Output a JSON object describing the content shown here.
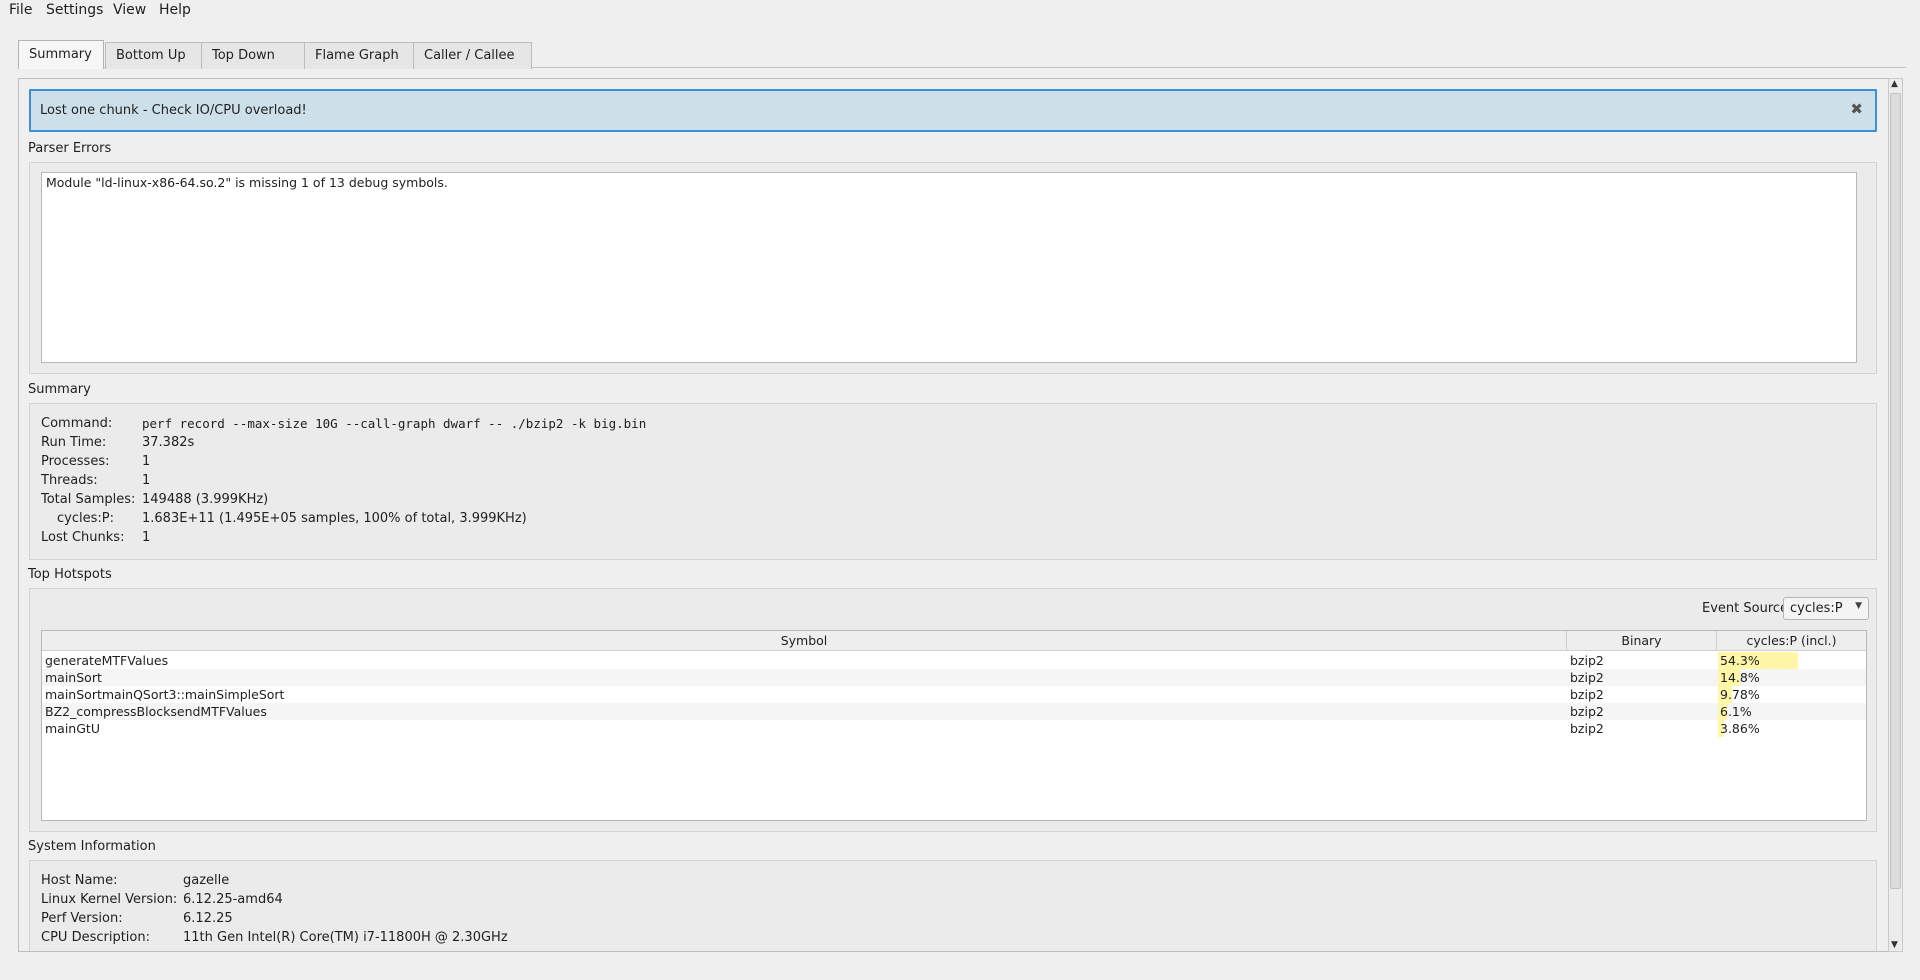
{
  "menu": {
    "file": "File",
    "settings": "Settings",
    "view": "View",
    "help": "Help"
  },
  "tabs": [
    "Summary",
    "Bottom Up",
    "Top Down",
    "Flame Graph",
    "Caller / Callee"
  ],
  "banner": {
    "message": "Lost one chunk - Check IO/CPU overload!",
    "close_icon": "close-icon"
  },
  "parser_errors": {
    "title": "Parser Errors",
    "text": "Module \"ld-linux-x86-64.so.2\" is missing 1 of 13 debug symbols."
  },
  "summary": {
    "title": "Summary",
    "rows": [
      {
        "label": "Command:",
        "value": "perf record --max-size 10G --call-graph dwarf -- ./bzip2 -k big.bin"
      },
      {
        "label": "Run Time:",
        "value": "37.382s"
      },
      {
        "label": "Processes:",
        "value": "1"
      },
      {
        "label": "Threads:",
        "value": "1"
      },
      {
        "label": "Total Samples:",
        "value": "149488 (3.999KHz)"
      },
      {
        "label": "cycles:P:",
        "value": "1.683E+11 (1.495E+05 samples, 100% of total, 3.999KHz)"
      },
      {
        "label": "Lost Chunks:",
        "value": "1"
      }
    ]
  },
  "hotspots": {
    "title": "Top Hotspots",
    "event_source_label": "Event Source:",
    "event_source_value": "cycles:P",
    "columns": [
      "Symbol",
      "Binary",
      "cycles:P (incl.)"
    ],
    "rows": [
      {
        "symbol": "generateMTFValues",
        "binary": "bzip2",
        "cost": "54.3%",
        "fraction": 0.543
      },
      {
        "symbol": "mainSort",
        "binary": "bzip2",
        "cost": "14.8%",
        "fraction": 0.148
      },
      {
        "symbol": "mainSortmainQSort3::mainSimpleSort",
        "binary": "bzip2",
        "cost": "9.78%",
        "fraction": 0.0978
      },
      {
        "symbol": "BZ2_compressBlocksendMTFValues",
        "binary": "bzip2",
        "cost": "6.1%",
        "fraction": 0.061
      },
      {
        "symbol": "mainGtU",
        "binary": "bzip2",
        "cost": "3.86%",
        "fraction": 0.0386
      }
    ]
  },
  "system_info": {
    "title": "System Information",
    "rows": [
      {
        "label": "Host Name:",
        "value": "gazelle"
      },
      {
        "label": "Linux Kernel Version:",
        "value": "6.12.25-amd64"
      },
      {
        "label": "Perf Version:",
        "value": "6.12.25"
      },
      {
        "label": "CPU Description:",
        "value": "11th Gen Intel(R) Core(TM) i7-11800H @ 2.30GHz"
      }
    ]
  }
}
